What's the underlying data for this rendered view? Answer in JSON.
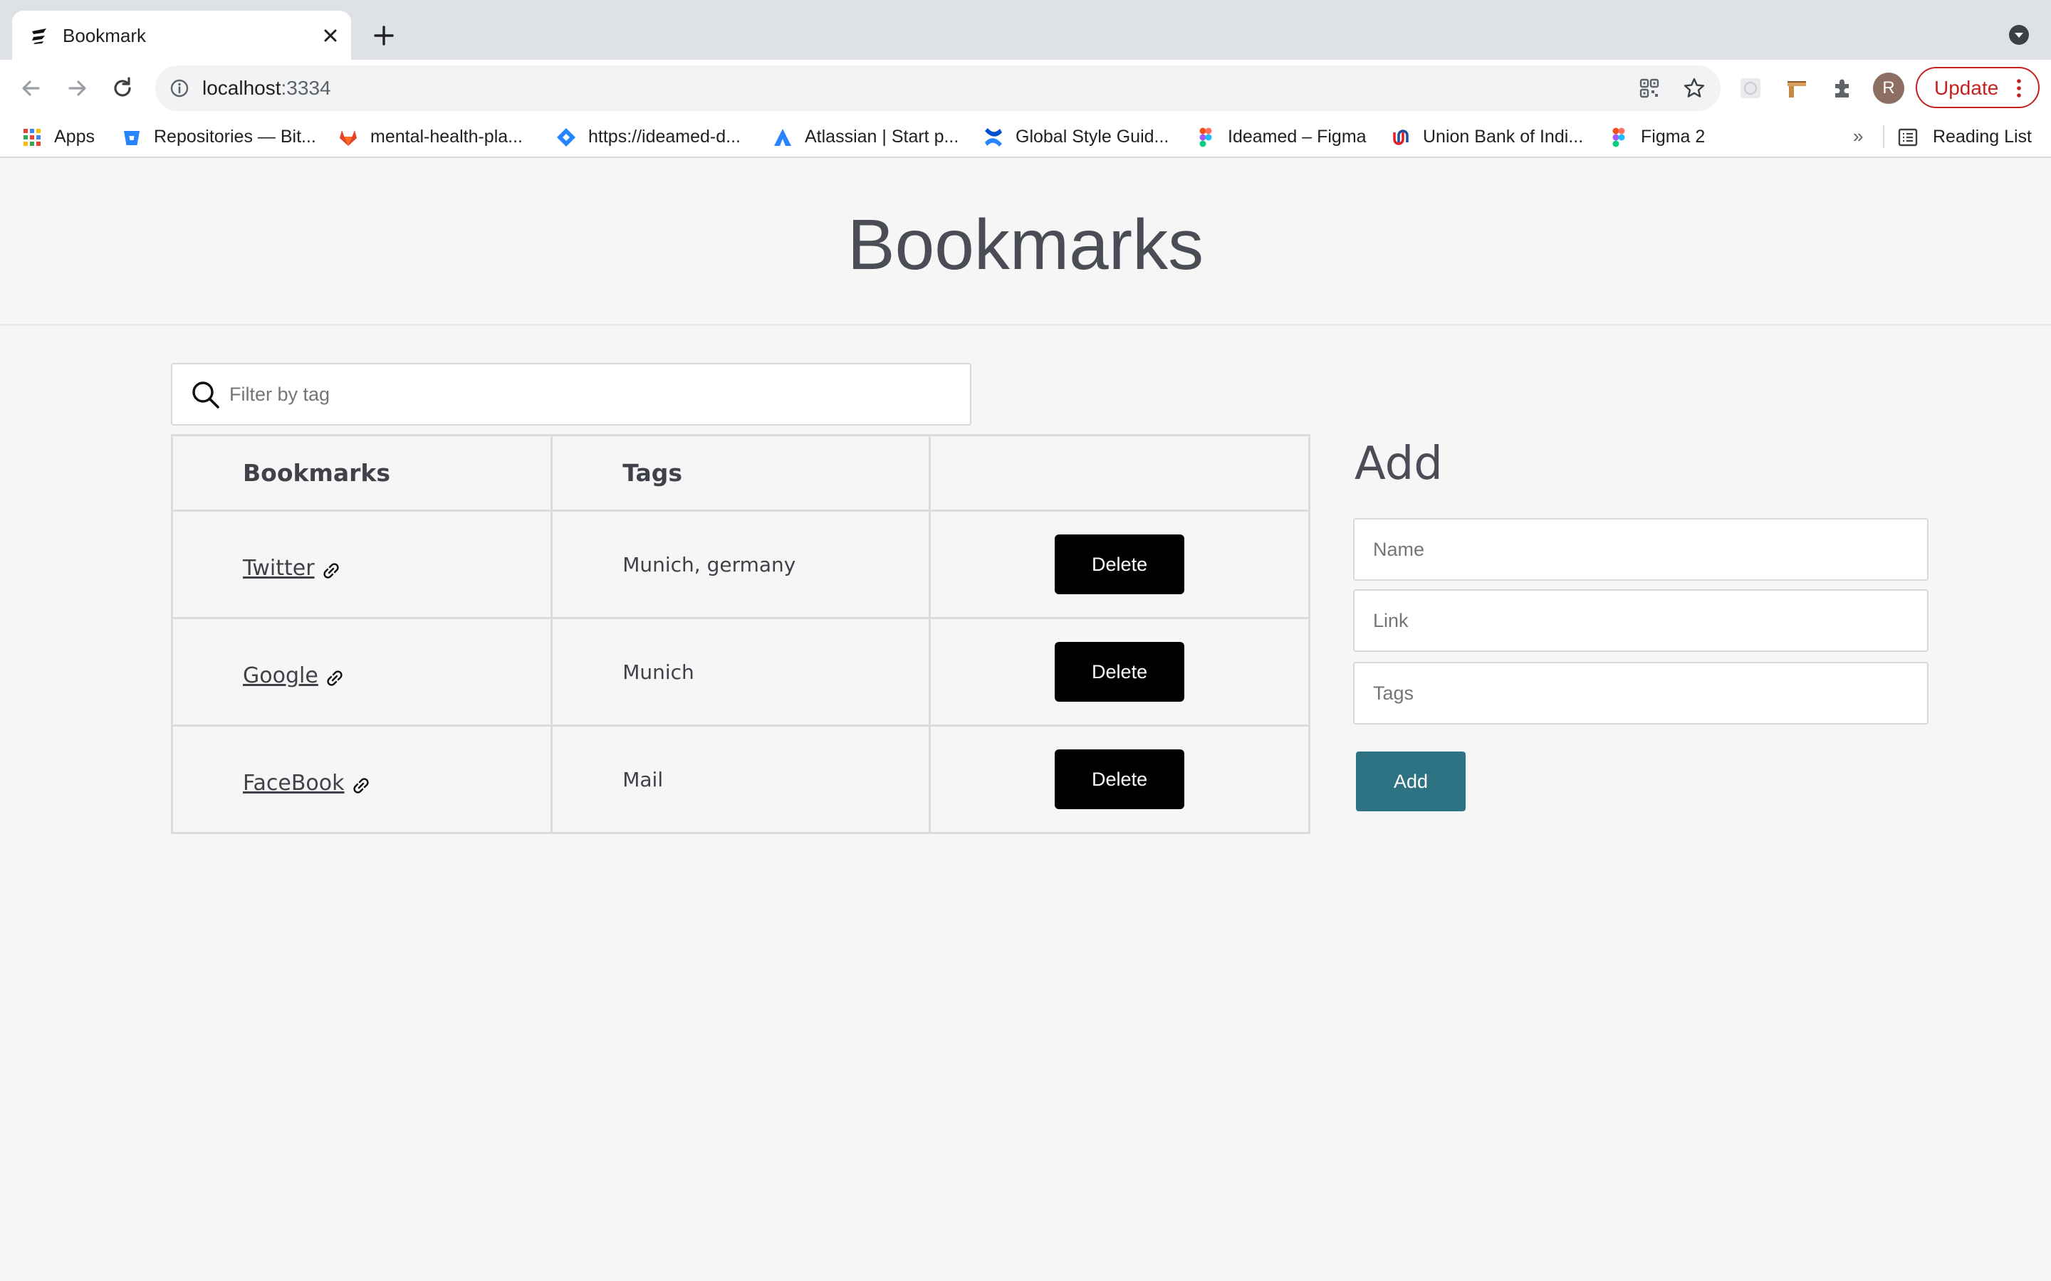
{
  "browser": {
    "tab_title": "Bookmark",
    "url_host": "localhost",
    "url_port": ":3334",
    "update_label": "Update",
    "avatar_initial": "R",
    "colors": {
      "update": "#c5221f",
      "tabstrip": "#dee1e6"
    }
  },
  "bookmarks_bar": {
    "items": [
      {
        "label": "Apps",
        "icon": "apps-grid-icon"
      },
      {
        "label": "Repositories — Bit...",
        "icon": "bitbucket-icon"
      },
      {
        "label": "mental-health-pla...",
        "icon": "gitlab-icon"
      },
      {
        "label": "https://ideamed-d...",
        "icon": "diamond-icon"
      },
      {
        "label": "Atlassian | Start p...",
        "icon": "atlassian-icon"
      },
      {
        "label": "Global Style Guid...",
        "icon": "confluence-icon"
      },
      {
        "label": "Ideamed – Figma",
        "icon": "figma-icon"
      },
      {
        "label": "Union Bank of Indi...",
        "icon": "unionbank-icon"
      },
      {
        "label": "Figma 2",
        "icon": "figma-icon"
      }
    ],
    "more": "»",
    "reading_list": "Reading List"
  },
  "page": {
    "title": "Bookmarks",
    "filter_placeholder": "Filter by tag",
    "table": {
      "headers": [
        "Bookmarks",
        "Tags",
        ""
      ],
      "rows": [
        {
          "name": "Twitter",
          "tags": "Munich, germany",
          "action": "Delete"
        },
        {
          "name": "Google",
          "tags": "Munich",
          "action": "Delete"
        },
        {
          "name": "FaceBook",
          "tags": "Mail",
          "action": "Delete"
        }
      ]
    },
    "add_form": {
      "title": "Add",
      "name_placeholder": "Name",
      "link_placeholder": "Link",
      "tags_placeholder": "Tags",
      "button_label": "Add",
      "button_color": "#2e7384"
    }
  }
}
